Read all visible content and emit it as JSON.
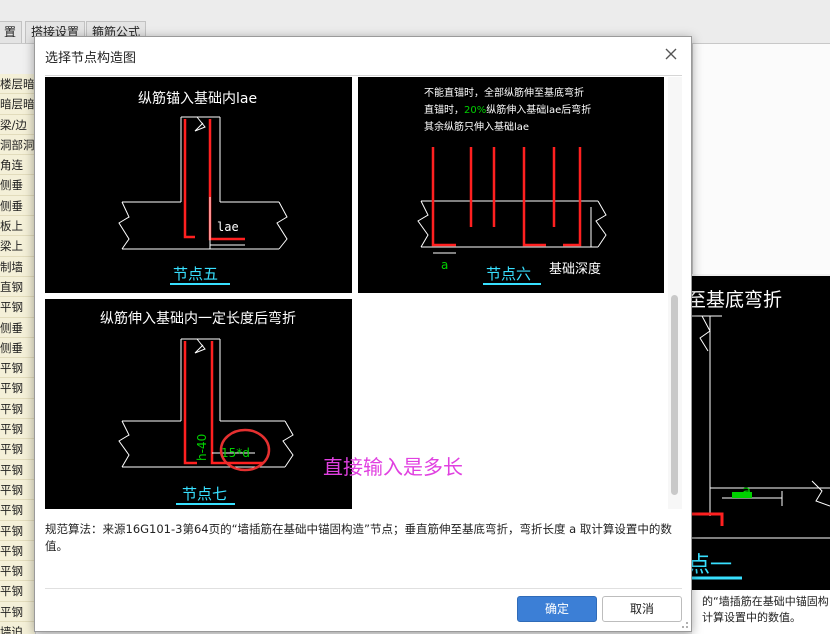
{
  "background_app": {
    "tabs": [
      "置",
      "搭接设置",
      "箍筋公式"
    ],
    "left_items": [
      "楼层暗",
      "暗层暗",
      "梁/边",
      "洞部洞",
      "角连",
      "侧垂",
      "侧垂",
      "板上",
      "梁上",
      "制墙",
      "直钢",
      "平钢",
      "侧垂",
      "侧垂",
      "平钢",
      "平钢",
      "平钢",
      "平钢",
      "平钢",
      "平钢",
      "平钢",
      "平钢",
      "平钢",
      "平钢",
      "平钢",
      "平钢",
      "平钢",
      "墙迫"
    ],
    "right_image": {
      "title": "至基底弯折",
      "dim_label": "a",
      "node_label": "点一"
    },
    "right_caption": [
      "的“墙插筋在基础中锚固构",
      "计算设置中的数值。"
    ]
  },
  "dialog": {
    "title": "选择节点构造图",
    "nodes": [
      {
        "id": "node5",
        "heading": "纵筋锚入基础内lae",
        "dim_label": "lae",
        "label": "节点五"
      },
      {
        "id": "node6",
        "heading_lines": [
          "不能直锚时，全部纵筋伸至基底弯折",
          "直锚时，",
          "20%",
          "纵筋伸入基础lae后弯折",
          "其余纵筋只伸入基础lae"
        ],
        "dim_label": "a",
        "side_label": "基础深度",
        "label": "节点六"
      },
      {
        "id": "node7",
        "heading": "纵筋伸入基础内一定长度后弯折",
        "vert_label": "h-40",
        "dim_label": "15*d",
        "label": "节点七"
      }
    ],
    "description": "规范算法：来源16G101-3第64页的“墙插筋在基础中锚固构造”节点；垂直筋伸至基底弯折，弯折长度 a 取计算设置中的数值。",
    "annotation": "直接输入是多长",
    "buttons": {
      "ok": "确定",
      "cancel": "取消"
    }
  },
  "colors": {
    "rebar": "#ff2020",
    "outline": "#ffffff",
    "label_underline": "#38e0ff",
    "highlight": "#00d000",
    "annotation": "#e040e0",
    "ok_button": "#3c7fd6"
  }
}
